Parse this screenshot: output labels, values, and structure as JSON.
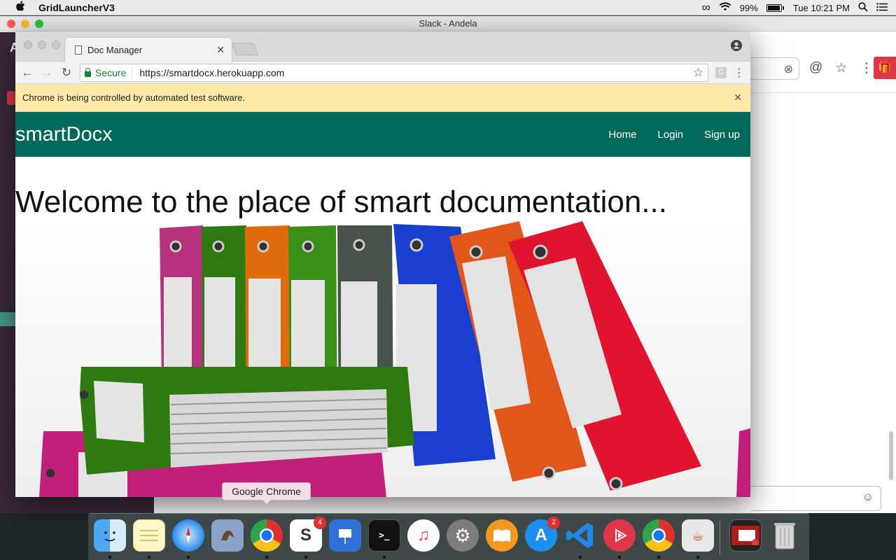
{
  "menubar": {
    "apple": "",
    "app_name": "GridLauncherV3",
    "battery": "99%",
    "clock": "Tue 10:21 PM"
  },
  "slack": {
    "title": "Slack - Andela",
    "workspace_initial": "A"
  },
  "chrome": {
    "tab_title": "Doc Manager",
    "secure_label": "Secure",
    "url": "https://smartdocx.herokuapp.com",
    "extension_letter": "C",
    "infobar_message": "Chrome is being controlled by automated test software."
  },
  "page": {
    "brand": "smartDocx",
    "nav": [
      "Home",
      "Login",
      "Sign up"
    ],
    "heading": "Welcome to the place of smart documentation..."
  },
  "dock": {
    "tooltip": "Google Chrome",
    "badges": {
      "slack": "4",
      "app_store": "2"
    }
  },
  "colors": {
    "navbar": "#00695c",
    "infobar": "#fdeaaa",
    "secure": "#188038"
  }
}
